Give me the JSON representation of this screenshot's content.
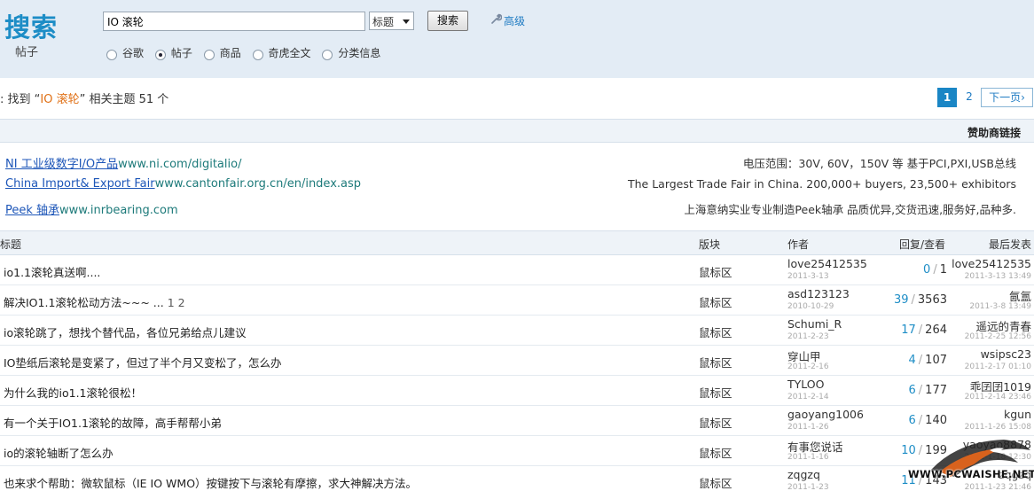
{
  "header": {
    "logo": "搜索",
    "sublabel": "帖子",
    "query": "IO 滚轮",
    "scope_select": "标题",
    "search_button": "搜索",
    "advanced_link": "高级",
    "radios": [
      {
        "label": "谷歌",
        "checked": false
      },
      {
        "label": "帖子",
        "checked": true
      },
      {
        "label": "商品",
        "checked": false
      },
      {
        "label": "奇虎全文",
        "checked": false
      },
      {
        "label": "分类信息",
        "checked": false
      }
    ]
  },
  "result": {
    "prefix": ": 找到 “",
    "keyword": "IO 滚轮",
    "suffix": "” 相关主题 51 个"
  },
  "pager": {
    "current": "1",
    "page2": "2",
    "next": "下一页›"
  },
  "sponsor": {
    "heading": "赞助商链接",
    "ads": [
      {
        "title": "NI 工业级数字I/O产品",
        "url": "www.ni.com/digitalio/",
        "desc": "电压范围：30V, 60V，150V 等 基于PCI,PXI,USB总线"
      },
      {
        "title": "China Import& Export Fair",
        "url": "www.cantonfair.org.cn/en/index.asp",
        "desc": "The Largest Trade Fair in China. 200,000+ buyers, 23,500+ exhibitors"
      },
      {
        "title": "Peek 轴承",
        "url": "www.inrbearing.com",
        "desc": "上海意纳实业专业制造Peek轴承 品质优异,交货迅速,服务好,品种多."
      }
    ]
  },
  "table": {
    "headers": {
      "title": "标题",
      "forum": "版块",
      "author": "作者",
      "stats": "回复/查看",
      "last": "最后发表"
    },
    "rows": [
      {
        "title": "io1.1滚轮真送啊....",
        "pages": "",
        "forum": "鼠标区",
        "author": "love25412535",
        "adate": "2011-3-13",
        "replies": "0",
        "views": "1",
        "last": "love25412535",
        "ldate": "2011-3-13 13:49"
      },
      {
        "title": "解决IO1.1滚轮松动方法~~~ ...",
        "pages": "1 2",
        "forum": "鼠标区",
        "author": "asd123123",
        "adate": "2010-10-29",
        "replies": "39",
        "views": "3563",
        "last": "氤氲",
        "ldate": "2011-3-8 13:49"
      },
      {
        "title": "io滚轮跳了，想找个替代品，各位兄弟给点儿建议",
        "pages": "",
        "forum": "鼠标区",
        "author": "Schumi_R",
        "adate": "2011-2-23",
        "replies": "17",
        "views": "264",
        "last": "遥远的青春",
        "ldate": "2011-2-25 12:56"
      },
      {
        "title": "IO垫纸后滚轮是变紧了，但过了半个月又变松了，怎么办",
        "pages": "",
        "forum": "鼠标区",
        "author": "穿山甲",
        "adate": "2011-2-16",
        "replies": "4",
        "views": "107",
        "last": "wsipsc23",
        "ldate": "2011-2-17 01:10"
      },
      {
        "title": "为什么我的io1.1滚轮很松！",
        "pages": "",
        "forum": "鼠标区",
        "author": "TYLOO",
        "adate": "2011-2-14",
        "replies": "6",
        "views": "177",
        "last": "乖囝囝1019",
        "ldate": "2011-2-14 23:46"
      },
      {
        "title": "有一个关于IO1.1滚轮的故障，高手帮帮小弟",
        "pages": "",
        "forum": "鼠标区",
        "author": "gaoyang1006",
        "adate": "2011-1-26",
        "replies": "6",
        "views": "140",
        "last": "kgun",
        "ldate": "2011-1-26 15:08"
      },
      {
        "title": "io的滚轮轴断了怎么办",
        "pages": "",
        "forum": "鼠标区",
        "author": "有事您说话",
        "adate": "2011-1-16",
        "replies": "10",
        "views": "199",
        "last": "yaoyao8878",
        "ldate": "2011-1-18 12:30"
      },
      {
        "title": "也来求个帮助：微软鼠标（IE IO WMO）按键按下与滚轮有摩擦，求大神解决方法。",
        "pages": "",
        "forum": "鼠标区",
        "author": "zqgzq",
        "adate": "2011-1-23",
        "replies": "11",
        "views": "143",
        "last": "zqgzq",
        "ldate": "2011-1-23 21:46"
      }
    ]
  },
  "watermark": "WWW.PCWAISHE.NET"
}
